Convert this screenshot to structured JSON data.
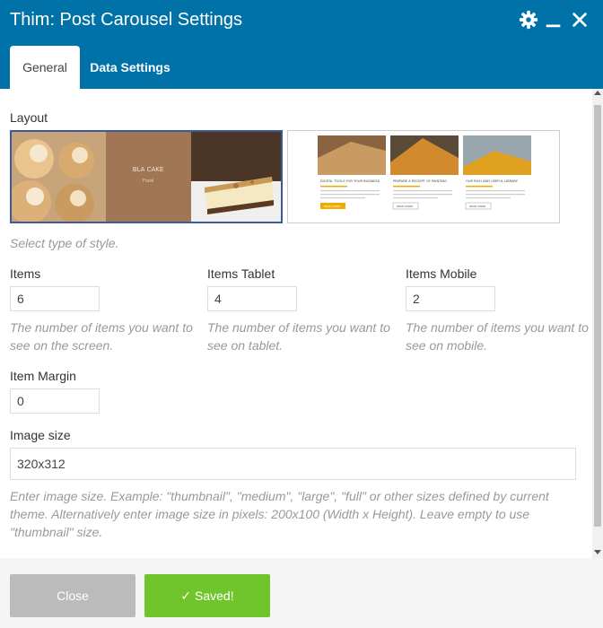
{
  "header": {
    "title": "Thim: Post Carousel Settings",
    "bg_color": "#0072a8",
    "icons": [
      "gear-icon",
      "minimize-icon",
      "close-icon"
    ]
  },
  "tabs": [
    {
      "label": "General",
      "active": true
    },
    {
      "label": "Data Settings",
      "active": false
    }
  ],
  "layout": {
    "label": "Layout",
    "help": "Select type of style.",
    "option1": {
      "caption_title": "BLA CAKE",
      "caption_sub": "Food",
      "selected": true
    },
    "option2": {
      "selected": false,
      "cards": [
        {
          "title": "DIGITAL TOOLS FOR YOUR BUSINESS",
          "button": "READ MORE"
        },
        {
          "title": "PREPARE A RECEIPT OF PAINTING",
          "button": "READ MORE"
        },
        {
          "title": "OUR RICH AND USEFUL LIBRARY",
          "button": "READ MORE"
        }
      ]
    }
  },
  "items": {
    "label": "Items",
    "value": "6",
    "help": "The number of items you want to see on the screen."
  },
  "items_tablet": {
    "label": "Items Tablet",
    "value": "4",
    "help": "The number of items you want to see on tablet."
  },
  "items_mobile": {
    "label": "Items Mobile",
    "value": "2",
    "help": "The number of items you want to see on mobile."
  },
  "item_margin": {
    "label": "Item Margin",
    "value": "0"
  },
  "image_size": {
    "label": "Image size",
    "value": "320x312",
    "help": "Enter image size. Example: \"thumbnail\", \"medium\", \"large\", \"full\" or other sizes defined by current theme. Alternatively enter image size in pixels: 200x100 (Width x Height). Leave empty to use \"thumbnail\" size."
  },
  "footer": {
    "close_label": "Close",
    "saved_label": "Saved!",
    "saved_color": "#71c52c"
  }
}
